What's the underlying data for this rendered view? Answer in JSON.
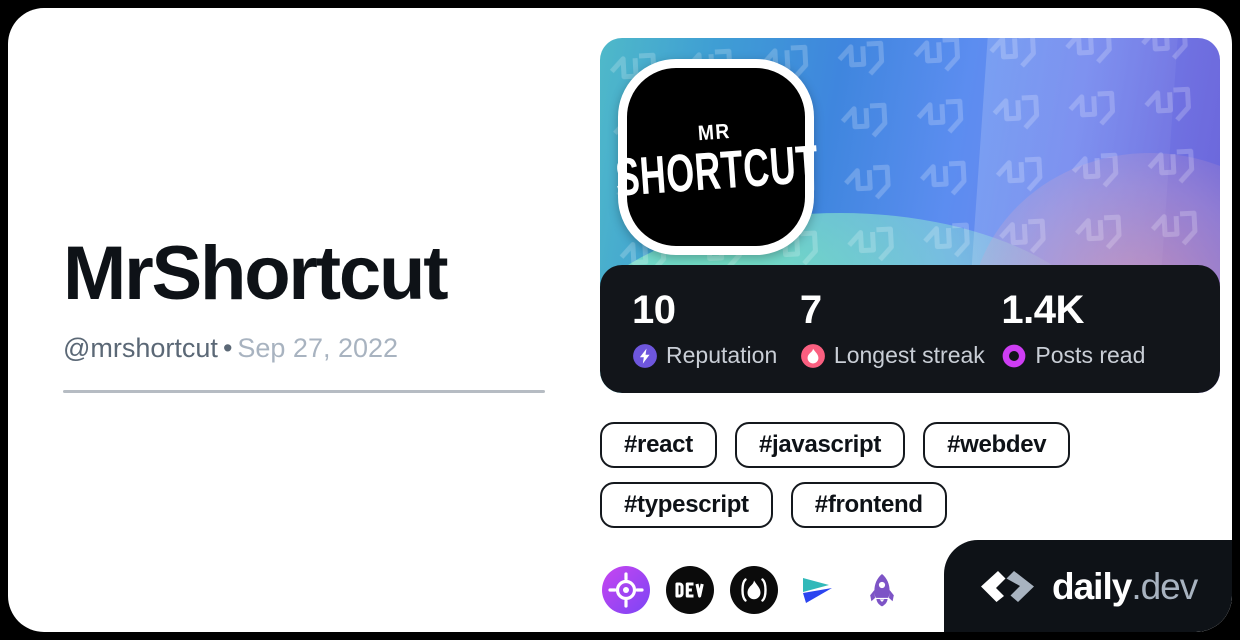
{
  "page": {
    "background_color": "#000000",
    "card_background": "#ffffff"
  },
  "profile": {
    "display_name": "MrShortcut",
    "handle": "@mrshortcut",
    "separator": "•",
    "joined_date": "Sep 27, 2022",
    "avatar": {
      "line1": "MR",
      "line2": "SHORTCUT",
      "background_color": "#000000",
      "border_color": "#ffffff"
    },
    "cover": {
      "gradient_from": "#4fb9c9",
      "gradient_mid": "#5c8df0",
      "gradient_to": "#6a62d8",
      "watermark": "daily-dev-chevron-pattern"
    }
  },
  "stats": {
    "background_color": "#12151a",
    "items": [
      {
        "value": "10",
        "label": "Reputation",
        "icon": "reputation-bolt-icon",
        "color": "#6E56DD"
      },
      {
        "value": "7",
        "label": "Longest streak",
        "icon": "streak-flame-icon",
        "color": "#FA5F80"
      },
      {
        "value": "1.4K",
        "label": "Posts read",
        "icon": "posts-read-ring-icon",
        "color": "#CE3DF3"
      }
    ]
  },
  "tags": [
    {
      "label": "#react"
    },
    {
      "label": "#javascript"
    },
    {
      "label": "#webdev"
    },
    {
      "label": "#typescript"
    },
    {
      "label": "#frontend"
    }
  ],
  "socials": [
    {
      "name": "roadmap-target-icon",
      "title": "roadmap.sh"
    },
    {
      "name": "devto-icon",
      "title": "DEV",
      "text": "DEV"
    },
    {
      "name": "hashnode-flame-icon",
      "title": "Hashnode"
    },
    {
      "name": "codepen-send-icon",
      "title": "Send"
    },
    {
      "name": "rocket-icon",
      "title": "Rocket"
    }
  ],
  "brand": {
    "name_primary": "daily",
    "name_secondary": ".dev",
    "logo": "daily-dev-logo-icon",
    "background_color": "#0E1217"
  }
}
